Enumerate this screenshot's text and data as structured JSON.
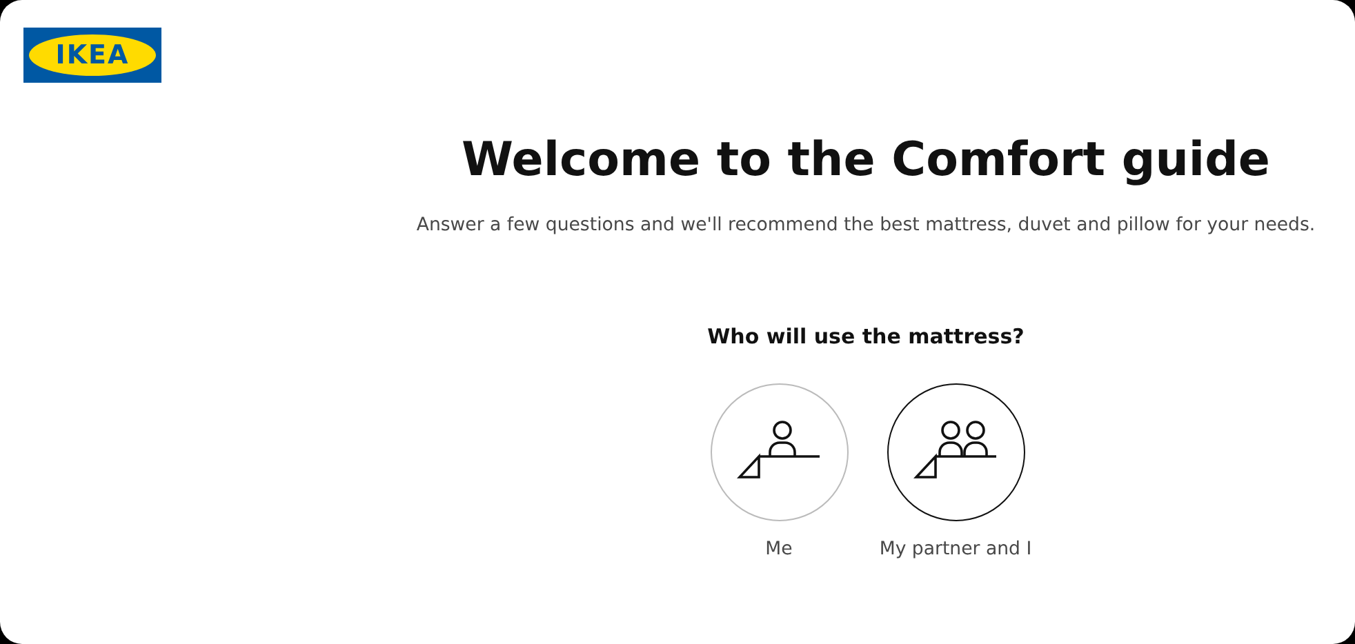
{
  "logo": {
    "text": "IKEA"
  },
  "title": "Welcome to the Comfort guide",
  "subtitle": "Answer a few questions and we'll recommend the best mattress, duvet and pillow for your needs.",
  "question": "Who will use the mattress?",
  "options": [
    {
      "label": "Me",
      "kind": "single",
      "selected": false
    },
    {
      "label": "My partner and I",
      "kind": "couple",
      "selected": true
    }
  ]
}
